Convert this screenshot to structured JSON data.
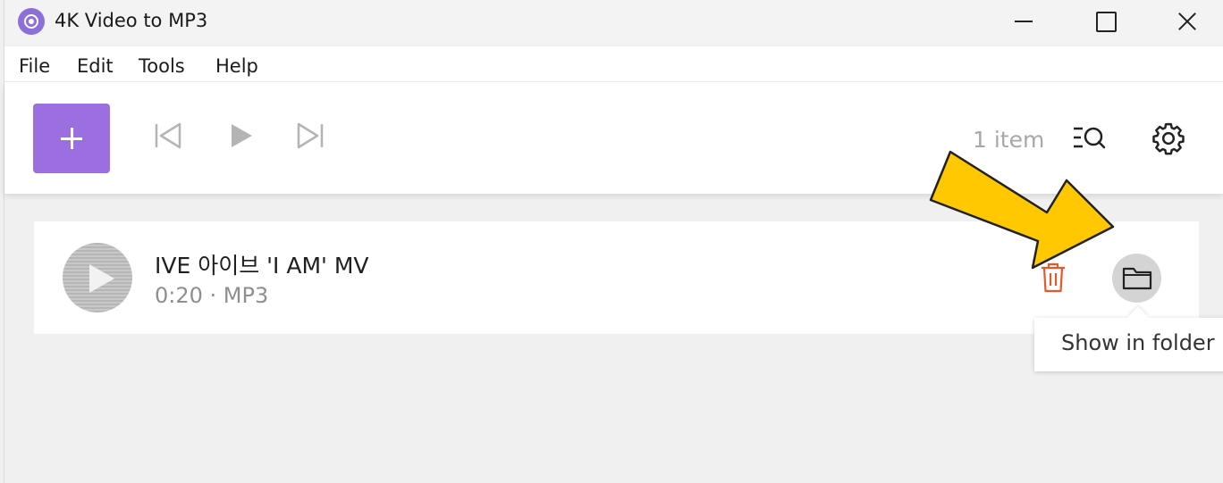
{
  "window": {
    "title": "4K Video to MP3"
  },
  "titlebar": {
    "controls": [
      "minimize-icon",
      "maximize-icon",
      "close-icon"
    ]
  },
  "menu": {
    "items": [
      {
        "label": "File"
      },
      {
        "label": "Edit"
      },
      {
        "label": "Tools"
      },
      {
        "label": "Help"
      }
    ]
  },
  "toolbar": {
    "add_icon": "plus-icon",
    "item_count": "1 item",
    "accent_color": "#9b6fe0"
  },
  "item": {
    "title": "IVE 아이브 'I AM' MV",
    "meta": "0:20 · MP3",
    "delete_color": "#e2592b"
  },
  "tooltip": {
    "text": "Show in folder"
  },
  "annotation": {
    "arrow_color": "#ffc800"
  }
}
